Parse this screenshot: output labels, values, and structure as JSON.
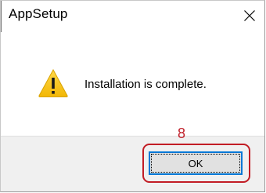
{
  "window": {
    "title": "AppSetup",
    "close_icon": "close-icon"
  },
  "dialog": {
    "icon": "warning-icon",
    "message": "Installation is complete.",
    "ok_label": "OK"
  },
  "annotation": {
    "step_number": "8",
    "highlight_color": "#c21d25"
  },
  "colors": {
    "footer_background": "#f0f0f0",
    "button_border": "#0078d7",
    "warning_yellow": "#f5c518"
  }
}
